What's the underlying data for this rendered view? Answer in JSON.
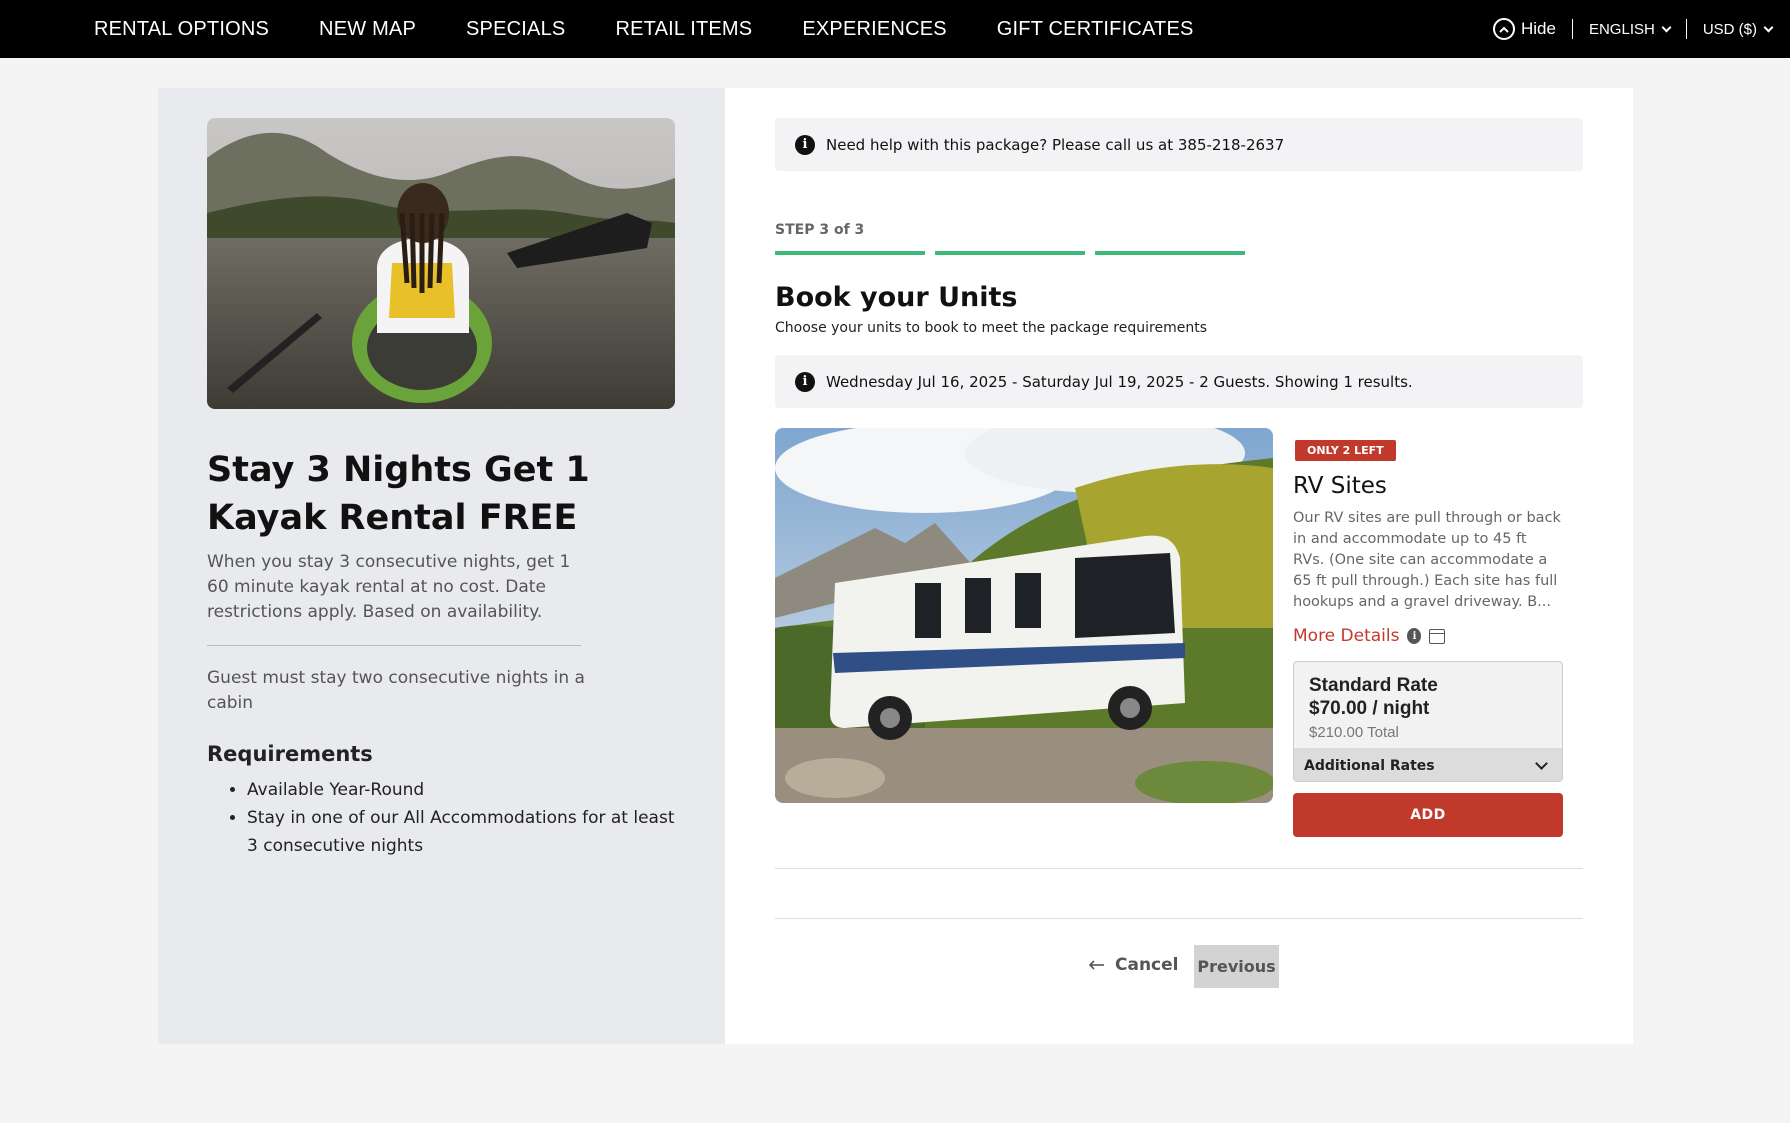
{
  "nav": {
    "items": [
      "RENTAL OPTIONS",
      "NEW MAP",
      "SPECIALS",
      "RETAIL ITEMS",
      "EXPERIENCES",
      "GIFT CERTIFICATES"
    ],
    "hide_label": "Hide",
    "language": "ENGLISH",
    "currency": "USD ($)"
  },
  "package": {
    "title": "Stay 3 Nights Get 1 Kayak Rental FREE",
    "description": "When you stay 3 consecutive nights, get 1 60 minute kayak rental at no cost. Date restrictions apply. Based on availability.",
    "note": "Guest must stay two consecutive nights in a cabin",
    "requirements_title": "Requirements",
    "requirements": [
      "Available Year-Round",
      "Stay in one of our All Accommodations for at least 3 consecutive nights"
    ]
  },
  "help": {
    "text": "Need help with this package? Please call us at 385-218-2637"
  },
  "steps": {
    "label": "STEP 3 of 3",
    "total": 3,
    "completed": 3
  },
  "booking": {
    "title": "Book your Units",
    "subtitle": "Choose your units to book to meet the package requirements",
    "search_info": "Wednesday Jul 16, 2025 - Saturday Jul 19, 2025 - 2 Guests. Showing 1 results."
  },
  "unit": {
    "badge": "ONLY 2 LEFT",
    "name": "RV Sites",
    "description": "Our RV sites are pull through or back in and accommodate up to 45 ft RVs. (One site can accommodate a 65 ft pull through.) Each site has full hookups and a gravel driveway. B...",
    "more_details": "More Details",
    "rate_name": "Standard Rate",
    "rate_price": "$70.00 / night",
    "rate_total": "$210.00 Total",
    "additional_rates": "Additional Rates",
    "add_label": "ADD"
  },
  "footer": {
    "cancel": "Cancel",
    "previous": "Previous"
  },
  "colors": {
    "accent": "#c0392b",
    "progress": "#3cb878",
    "nav_bg": "#000000"
  }
}
